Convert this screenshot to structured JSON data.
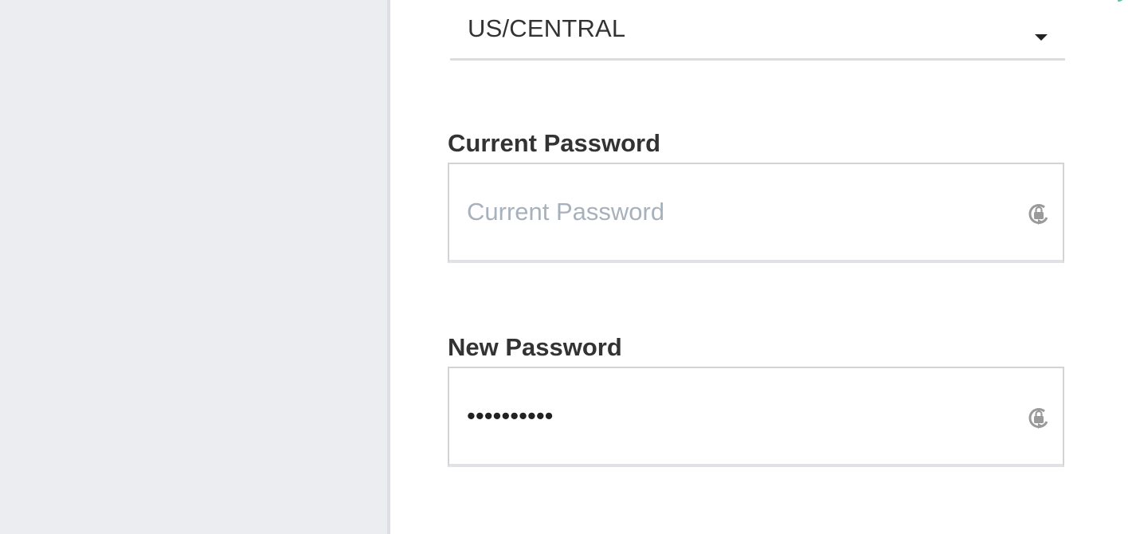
{
  "timezone": {
    "selected": "US/CENTRAL",
    "caret_icon": "caret-down-icon"
  },
  "current_password": {
    "label": "Current Password",
    "placeholder": "Current Password",
    "value": "",
    "icon": "lock-refresh-icon"
  },
  "new_password": {
    "label": "New Password",
    "masked_value": "••••••••••",
    "icon": "lock-refresh-icon"
  },
  "colors": {
    "sidebar_bg": "#ebedf0",
    "placeholder": "#a7b1bc",
    "accent": "#5cbfa8"
  }
}
